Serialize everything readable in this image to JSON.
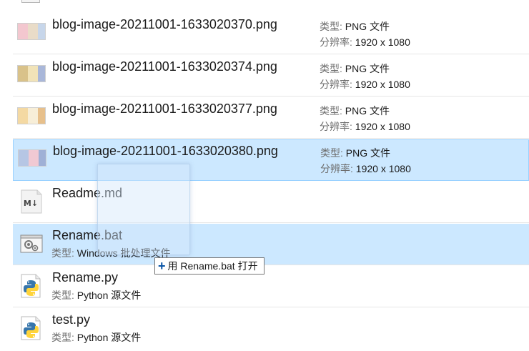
{
  "files": [
    {
      "name": "blog-image-20211001-1633020370.png",
      "type_label": "类型:",
      "type_value": "PNG 文件",
      "res_label": "分辨率:",
      "res_value": "1920 x 1080",
      "thumb_colors": [
        "#f3c7cf",
        "#e9dcc8",
        "#c7d6ea"
      ]
    },
    {
      "name": "blog-image-20211001-1633020374.png",
      "type_label": "类型:",
      "type_value": "PNG 文件",
      "res_label": "分辨率:",
      "res_value": "1920 x 1080",
      "thumb_colors": [
        "#d9c28a",
        "#f1e3b8",
        "#a9b7d9"
      ]
    },
    {
      "name": "blog-image-20211001-1633020377.png",
      "type_label": "类型:",
      "type_value": "PNG 文件",
      "res_label": "分辨率:",
      "res_value": "1920 x 1080",
      "thumb_colors": [
        "#f4d9a3",
        "#f7eed8",
        "#e7c08c"
      ]
    },
    {
      "name": "blog-image-20211001-1633020380.png",
      "type_label": "类型:",
      "type_value": "PNG 文件",
      "res_label": "分辨率:",
      "res_value": "1920 x 1080",
      "thumb_colors": [
        "#b6c6e4",
        "#f0c9d3",
        "#9fb0d6"
      ]
    },
    {
      "name": "Readme.md",
      "icon": "markdown-file-icon",
      "icon_text": "M↓"
    },
    {
      "name": "Rename.bat",
      "icon": "batch-file-icon",
      "type_label": "类型:",
      "type_value": "Windows 批处理文件"
    },
    {
      "name": "Rename.py",
      "icon": "python-file-icon",
      "type_label": "类型:",
      "type_value": "Python 源文件"
    },
    {
      "name": "test.py",
      "icon": "python-file-icon",
      "type_label": "类型:",
      "type_value": "Python 源文件"
    }
  ],
  "drag_tooltip": {
    "plus": "+",
    "text": "用 Rename.bat 打开"
  },
  "colors": {
    "selection_bg": "#cce8ff",
    "selection_border": "#99d1ff",
    "python_blue": "#3776ab",
    "python_yellow": "#ffd43b"
  }
}
